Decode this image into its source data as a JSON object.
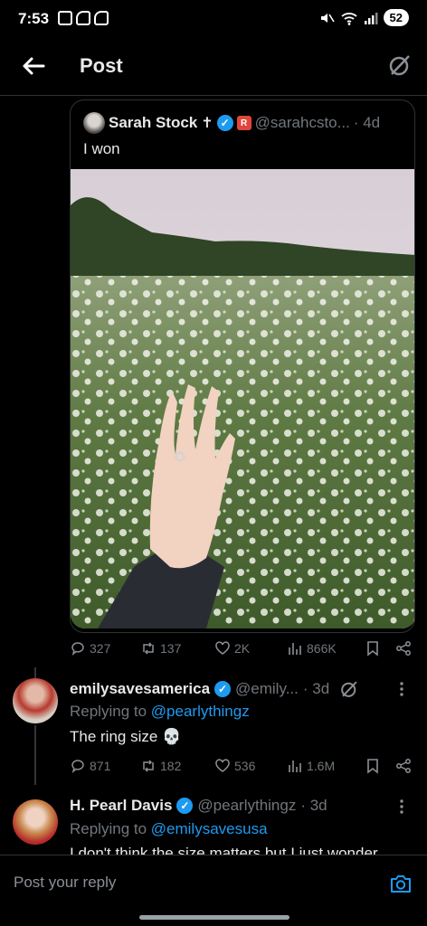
{
  "status_bar": {
    "time": "7:53",
    "battery": "52"
  },
  "header": {
    "title": "Post"
  },
  "quoted_post": {
    "author_name": "Sarah Stock",
    "handle": "@sarahcsto...",
    "time": "· 4d",
    "text": "I won"
  },
  "post_stats": {
    "replies": "327",
    "reposts": "137",
    "likes": "2K",
    "views": "866K"
  },
  "replies": [
    {
      "name": "emilysavesamerica",
      "handle": "@emily...",
      "time": "· 3d",
      "replying_prefix": "Replying to ",
      "replying_to": "@pearlythingz",
      "text": "The ring size 💀",
      "stats": {
        "replies": "871",
        "reposts": "182",
        "likes": "536",
        "views": "1.6M"
      }
    },
    {
      "name": "H. Pearl Davis",
      "handle": "@pearlythingz",
      "time": "· 3d",
      "replying_prefix": "Replying to ",
      "replying_to": "@emilysavesusa",
      "text": "I don't think the size matters but I just wonder"
    }
  ],
  "compose": {
    "placeholder": "Post your reply"
  },
  "colors": {
    "accent": "#1d9bf0",
    "background": "#000000",
    "muted": "#71767b"
  }
}
